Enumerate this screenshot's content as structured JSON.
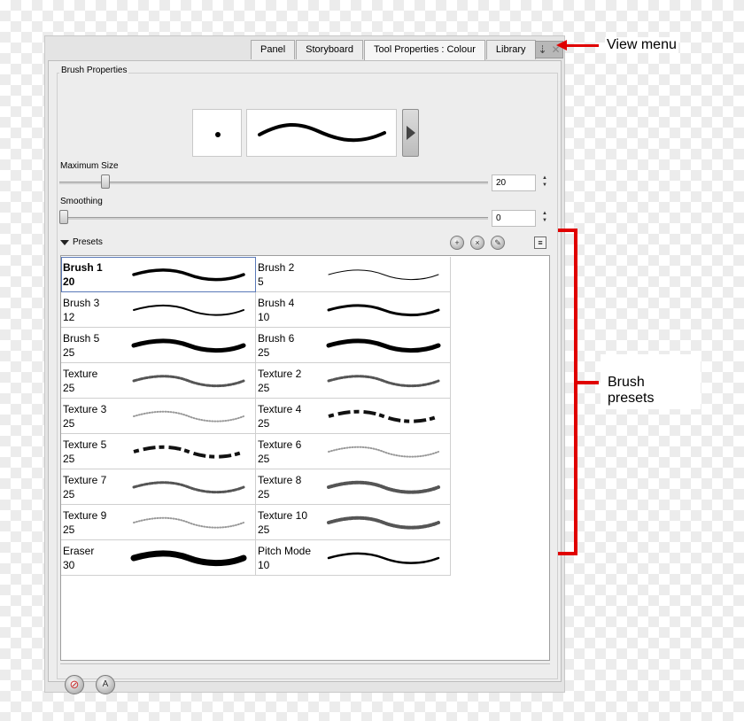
{
  "tabs": [
    {
      "label": "Panel",
      "active": false
    },
    {
      "label": "Storyboard",
      "active": false
    },
    {
      "label": "Tool Properties : Colour",
      "active": true
    },
    {
      "label": "Library",
      "active": false
    }
  ],
  "brush_properties": {
    "title": "Brush Properties",
    "maximum_size": {
      "label": "Maximum Size",
      "value": "20",
      "slider_level": 0.1
    },
    "smoothing": {
      "label": "Smoothing",
      "value": "0",
      "slider_level": 0.0
    }
  },
  "presets": {
    "label": "Presets",
    "items": [
      {
        "name": "Brush 1",
        "size": "20",
        "selected": true,
        "style": "solid",
        "width": 3.5
      },
      {
        "name": "Brush 2",
        "size": "5",
        "selected": false,
        "style": "solid",
        "width": 1
      },
      {
        "name": "Brush 3",
        "size": "12",
        "selected": false,
        "style": "solid",
        "width": 2
      },
      {
        "name": "Brush 4",
        "size": "10",
        "selected": false,
        "style": "solid",
        "width": 3
      },
      {
        "name": "Brush 5",
        "size": "25",
        "selected": false,
        "style": "solid",
        "width": 5
      },
      {
        "name": "Brush 6",
        "size": "25",
        "selected": false,
        "style": "solid",
        "width": 5
      },
      {
        "name": "Texture",
        "size": "25",
        "selected": false,
        "style": "texture",
        "width": 3
      },
      {
        "name": "Texture 2",
        "size": "25",
        "selected": false,
        "style": "texture",
        "width": 3
      },
      {
        "name": "Texture 3",
        "size": "25",
        "selected": false,
        "style": "texture-light",
        "width": 2
      },
      {
        "name": "Texture 4",
        "size": "25",
        "selected": false,
        "style": "dashed",
        "width": 4
      },
      {
        "name": "Texture 5",
        "size": "25",
        "selected": false,
        "style": "dashed",
        "width": 4
      },
      {
        "name": "Texture 6",
        "size": "25",
        "selected": false,
        "style": "texture-light",
        "width": 2
      },
      {
        "name": "Texture 7",
        "size": "25",
        "selected": false,
        "style": "texture",
        "width": 3
      },
      {
        "name": "Texture 8",
        "size": "25",
        "selected": false,
        "style": "texture",
        "width": 4
      },
      {
        "name": "Texture 9",
        "size": "25",
        "selected": false,
        "style": "texture-light",
        "width": 2
      },
      {
        "name": "Texture 10",
        "size": "25",
        "selected": false,
        "style": "texture",
        "width": 4
      },
      {
        "name": "Eraser",
        "size": "30",
        "selected": false,
        "style": "solid",
        "width": 7
      },
      {
        "name": "Pitch Mode",
        "size": "10",
        "selected": false,
        "style": "solid",
        "width": 2.5
      }
    ]
  },
  "annotations": {
    "view_menu": "View menu",
    "brush_presets": "Brush presets"
  },
  "colors": {
    "annotation": "#e00000",
    "selection": "#5a79b8"
  },
  "icons": [
    "view-menu-icon",
    "new-preset-icon",
    "delete-preset-icon",
    "rename-preset-icon",
    "preset-menu-icon",
    "eraser-mode-icon",
    "pressure-icon"
  ]
}
